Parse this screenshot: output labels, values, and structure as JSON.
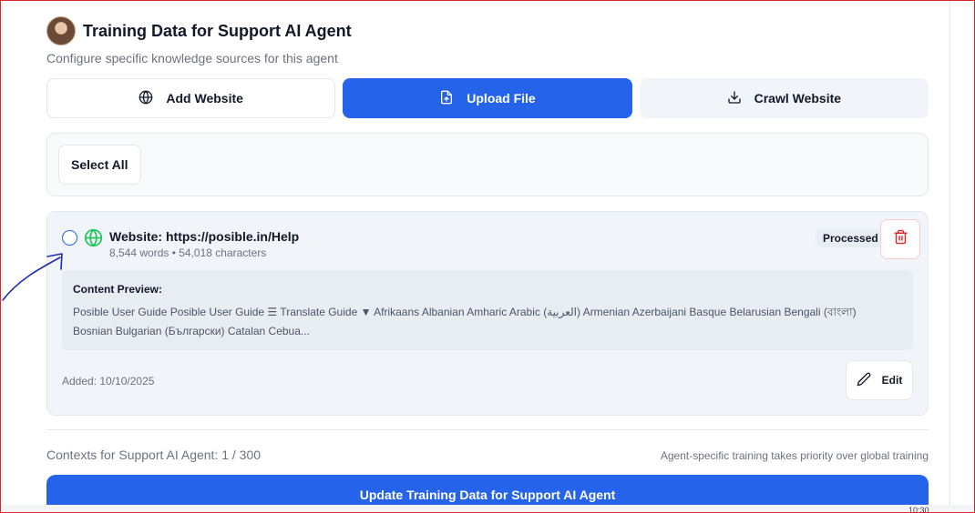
{
  "header": {
    "title": "Training Data for Support AI Agent",
    "subtitle": "Configure specific knowledge sources for this agent"
  },
  "tabs": [
    {
      "label": "Add Website",
      "icon": "globe-icon"
    },
    {
      "label": "Upload File",
      "icon": "file-upload-icon"
    },
    {
      "label": "Crawl Website",
      "icon": "download-icon"
    }
  ],
  "selection": {
    "select_all_label": "Select All"
  },
  "source": {
    "title": "Website: https://posible.in/Help",
    "meta": "8,544 words • 54,018 characters",
    "status": "Processed",
    "preview_label": "Content Preview:",
    "preview_text": "Posible User Guide Posible User Guide ☰ Translate Guide ▼ Afrikaans Albanian Amharic Arabic (العربية) Armenian Azerbaijani Basque Belarusian Bengali (বাংলা) Bosnian Bulgarian (Български) Catalan Cebua...",
    "added": "Added: 10/10/2025",
    "edit_label": "Edit"
  },
  "footer": {
    "contexts": "Contexts for Support AI Agent: 1 / 300",
    "priority_note": "Agent-specific training takes priority over global training",
    "update_label": "Update Training Data for Support AI Agent"
  },
  "taskbar": {
    "time": "10:30"
  },
  "colors": {
    "primary": "#2563eb",
    "success": "#22c55e",
    "danger": "#dc2626"
  }
}
